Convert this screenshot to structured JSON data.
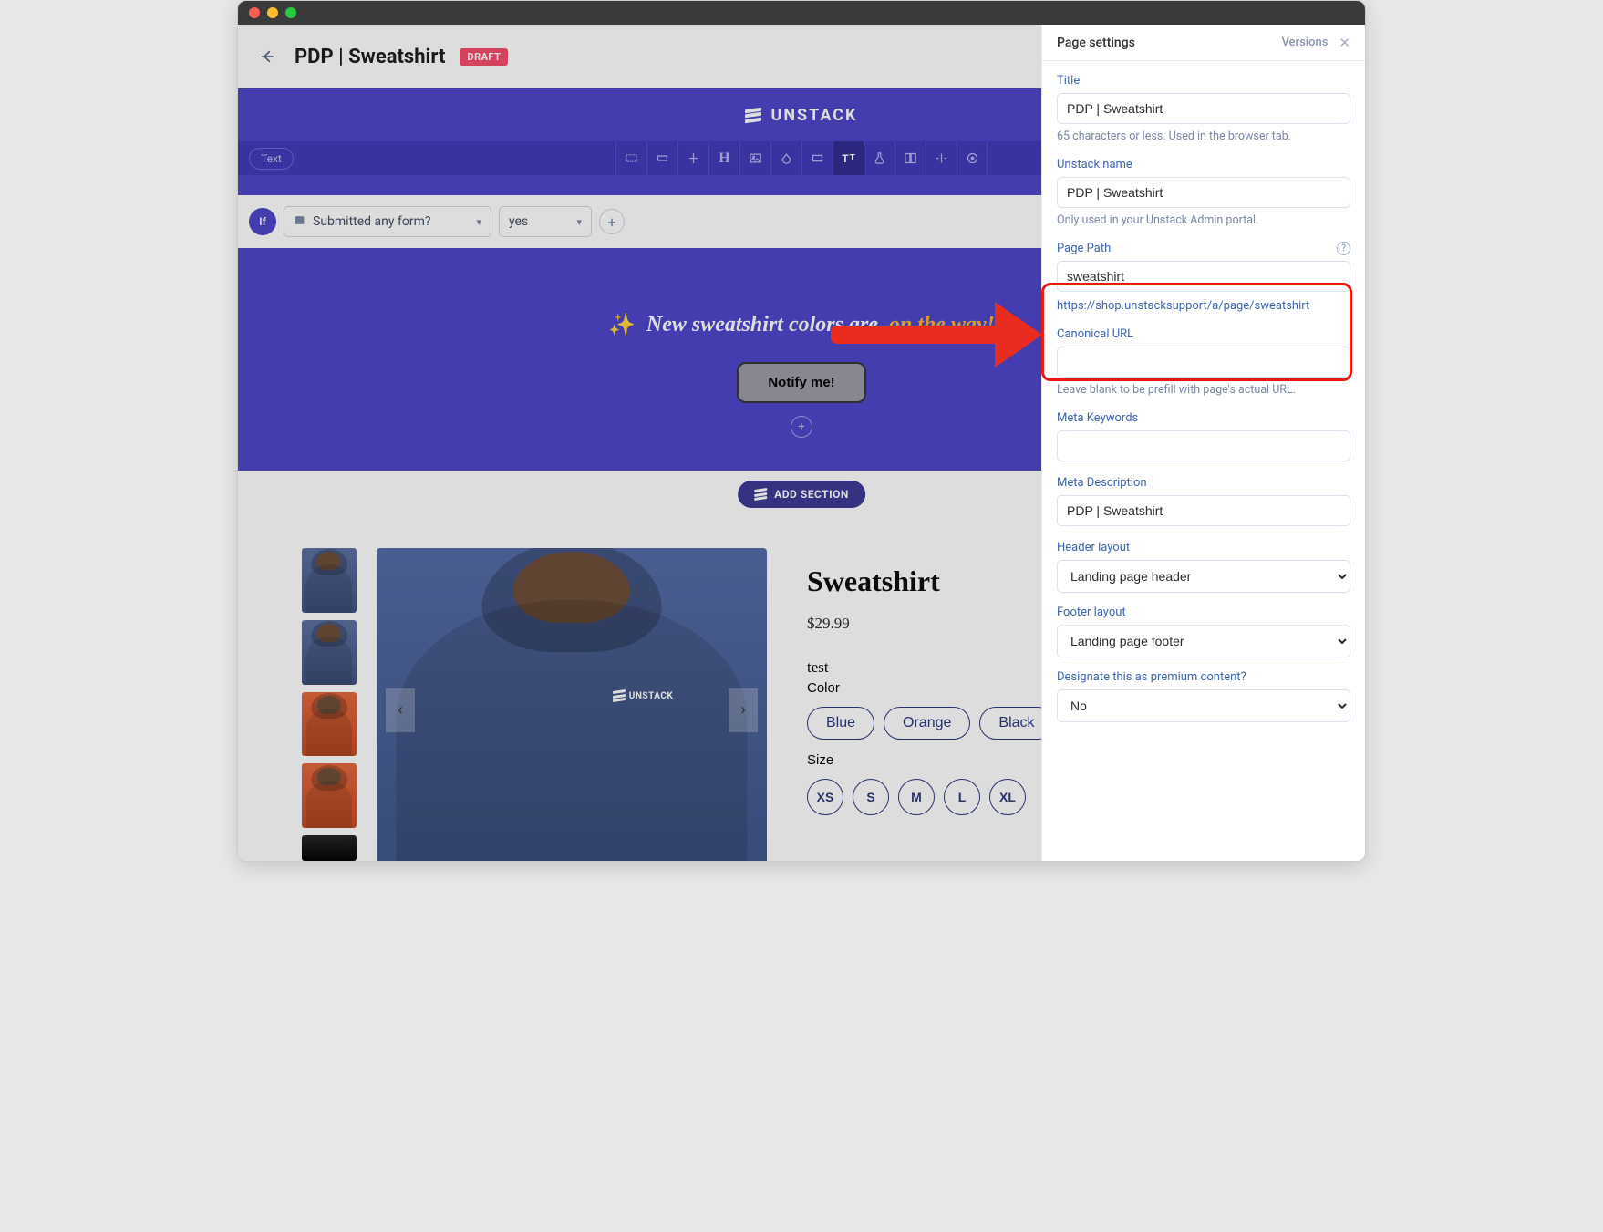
{
  "header": {
    "page_title": "PDP | Sweatshirt",
    "status_badge": "DRAFT"
  },
  "hero_brand": "UNSTACK",
  "toolbar": {
    "text_pill": "Text"
  },
  "logic_bar": {
    "if_label": "If",
    "condition": "Submitted any form?",
    "value": "yes"
  },
  "notify_section": {
    "headline_prefix": "New sweatshirt colors are",
    "headline_struck": "on the way!",
    "button": "Notify me!"
  },
  "add_section_label": "ADD SECTION",
  "product": {
    "title": "Sweatshirt",
    "price": "$29.99",
    "test_label": "test",
    "color_label": "Color",
    "colors": [
      "Blue",
      "Orange",
      "Black"
    ],
    "size_label": "Size",
    "sizes": [
      "XS",
      "S",
      "M",
      "L",
      "XL"
    ]
  },
  "side_panel": {
    "header": "Page settings",
    "versions": "Versions",
    "title_label": "Title",
    "title_value": "PDP | Sweatshirt",
    "title_hint": "65 characters or less. Used in the browser tab.",
    "unstack_name_label": "Unstack name",
    "unstack_name_value": "PDP | Sweatshirt",
    "unstack_name_hint": "Only used in your Unstack Admin portal.",
    "page_path_label": "Page Path",
    "page_path_value": "sweatshirt",
    "page_path_url": "https://shop.unstacksupport/a/page/sweatshirt",
    "canonical_label": "Canonical URL",
    "canonical_value": "",
    "canonical_hint": "Leave blank to be prefill with page's actual URL.",
    "meta_keywords_label": "Meta Keywords",
    "meta_keywords_value": "",
    "meta_description_label": "Meta Description",
    "meta_description_value": "PDP | Sweatshirt",
    "header_layout_label": "Header layout",
    "header_layout_value": "Landing page header",
    "footer_layout_label": "Footer layout",
    "footer_layout_value": "Landing page footer",
    "premium_label": "Designate this as premium content?",
    "premium_value": "No"
  }
}
